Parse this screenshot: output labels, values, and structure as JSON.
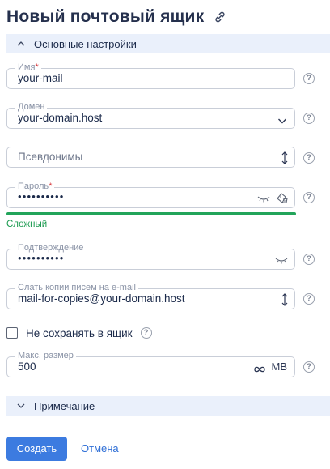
{
  "page": {
    "title": "Новый почтовый ящик"
  },
  "sections": {
    "main_settings": "Основные настройки",
    "note": "Примечание"
  },
  "fields": {
    "name": {
      "label": "Имя",
      "required_mark": "*",
      "value": "your-mail"
    },
    "domain": {
      "label": "Домен",
      "value": "your-domain.host"
    },
    "aliases": {
      "placeholder": "Псевдонимы"
    },
    "password": {
      "label": "Пароль",
      "required_mark": "*",
      "value": "••••••••••",
      "strength": "Сложный",
      "strength_fraction": 1.0
    },
    "confirm": {
      "label": "Подтверждение",
      "value": "••••••••••"
    },
    "copies": {
      "label": "Слать копии писем на e-mail",
      "value": "mail-for-copies@your-domain.host"
    },
    "dont_save": {
      "label": "Не сохранять в ящик",
      "checked": false
    },
    "max_size": {
      "label": "Макс. размер",
      "value": "500",
      "unit": "MB"
    }
  },
  "help_mark": "?",
  "actions": {
    "create": "Создать",
    "cancel": "Отмена"
  },
  "colors": {
    "accent": "#3c7be0",
    "strength": "#22a45a",
    "section_bg": "#eaf0fb",
    "required": "#d6353a"
  },
  "icons": [
    "link-icon",
    "chevron-up-icon",
    "chevron-down-icon",
    "sort-arrows-icon",
    "eye-closed-icon",
    "password-generate-icon",
    "infinity-icon",
    "help-icon"
  ]
}
